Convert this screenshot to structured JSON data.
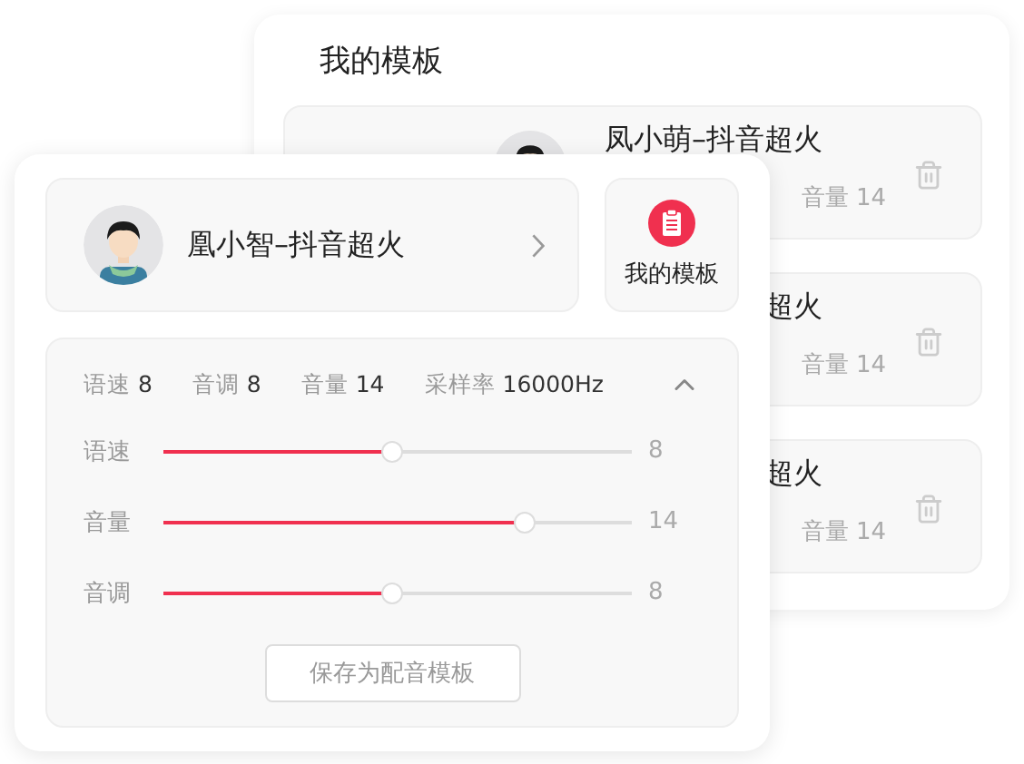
{
  "templates_panel": {
    "title": "我的模板",
    "items": [
      {
        "name": "凤小萌–抖音超火",
        "volume": "音量 14",
        "avatar": true
      },
      {
        "name": "超火",
        "volume": "音量 14",
        "avatar": false
      },
      {
        "name": "超火",
        "volume": "音量 14",
        "avatar": false
      }
    ]
  },
  "voice": {
    "name": "凰小智–抖音超火"
  },
  "templates_button": {
    "label": "我的模板"
  },
  "params": {
    "expanded": true,
    "summary": [
      {
        "label": "语速",
        "value": "8"
      },
      {
        "label": "音调",
        "value": "8"
      },
      {
        "label": "音量",
        "value": "14"
      },
      {
        "label": "采样率",
        "value": "16000Hz"
      }
    ],
    "sliders": [
      {
        "label": "语速",
        "level": 0.49,
        "reading": "8"
      },
      {
        "label": "音量",
        "level": 0.77,
        "reading": "14"
      },
      {
        "label": "音调",
        "level": 0.49,
        "reading": "8"
      }
    ],
    "save_button": "保存为配音模板"
  }
}
